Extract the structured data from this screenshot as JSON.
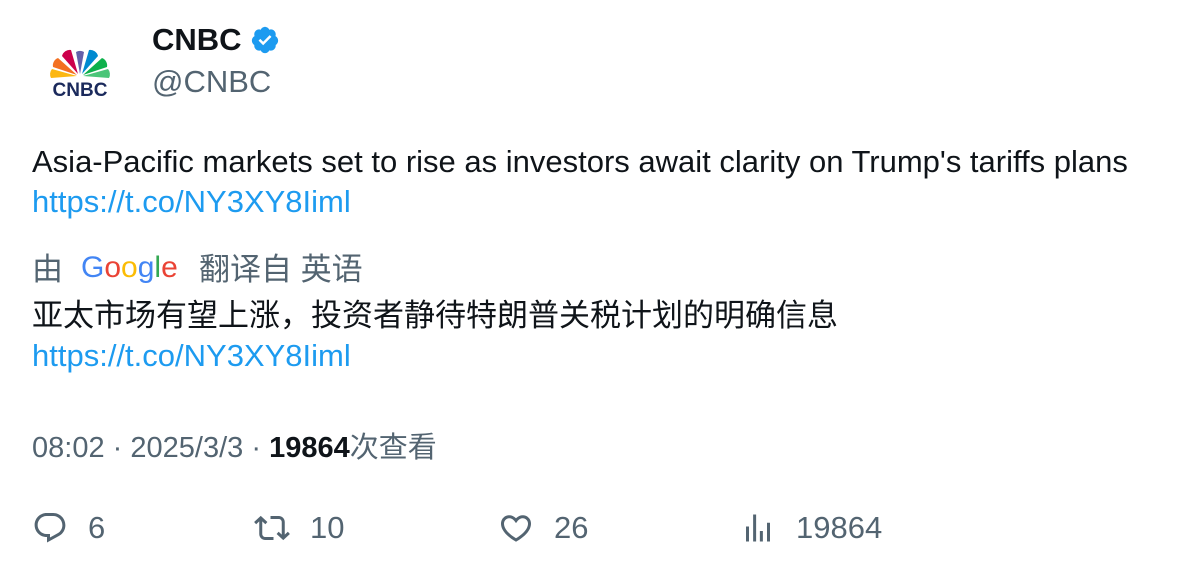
{
  "author": {
    "display_name": "CNBC",
    "handle": "@CNBC",
    "logo_text": "CNBC",
    "verified_color": "#1d9bf0"
  },
  "tweet": {
    "text": "Asia-Pacific markets set to rise as investors await clarity on Trump's tariffs plans",
    "link": "https://t.co/NY3XY8Iiml"
  },
  "translation": {
    "prefix": "由",
    "provider": "Google",
    "suffix": "翻译自 英语",
    "text": "亚太市场有望上涨，投资者静待特朗普关税计划的明确信息",
    "link": "https://t.co/NY3XY8Iiml"
  },
  "meta": {
    "time": "08:02",
    "separator": "·",
    "date": "2025/3/3",
    "views_count": "19864",
    "views_label": "次查看"
  },
  "actions": {
    "replies": "6",
    "retweets": "10",
    "likes": "26",
    "views": "19864"
  },
  "colors": {
    "link": "#1d9bf0",
    "secondary_text": "#536471",
    "primary_text": "#0f1419"
  }
}
